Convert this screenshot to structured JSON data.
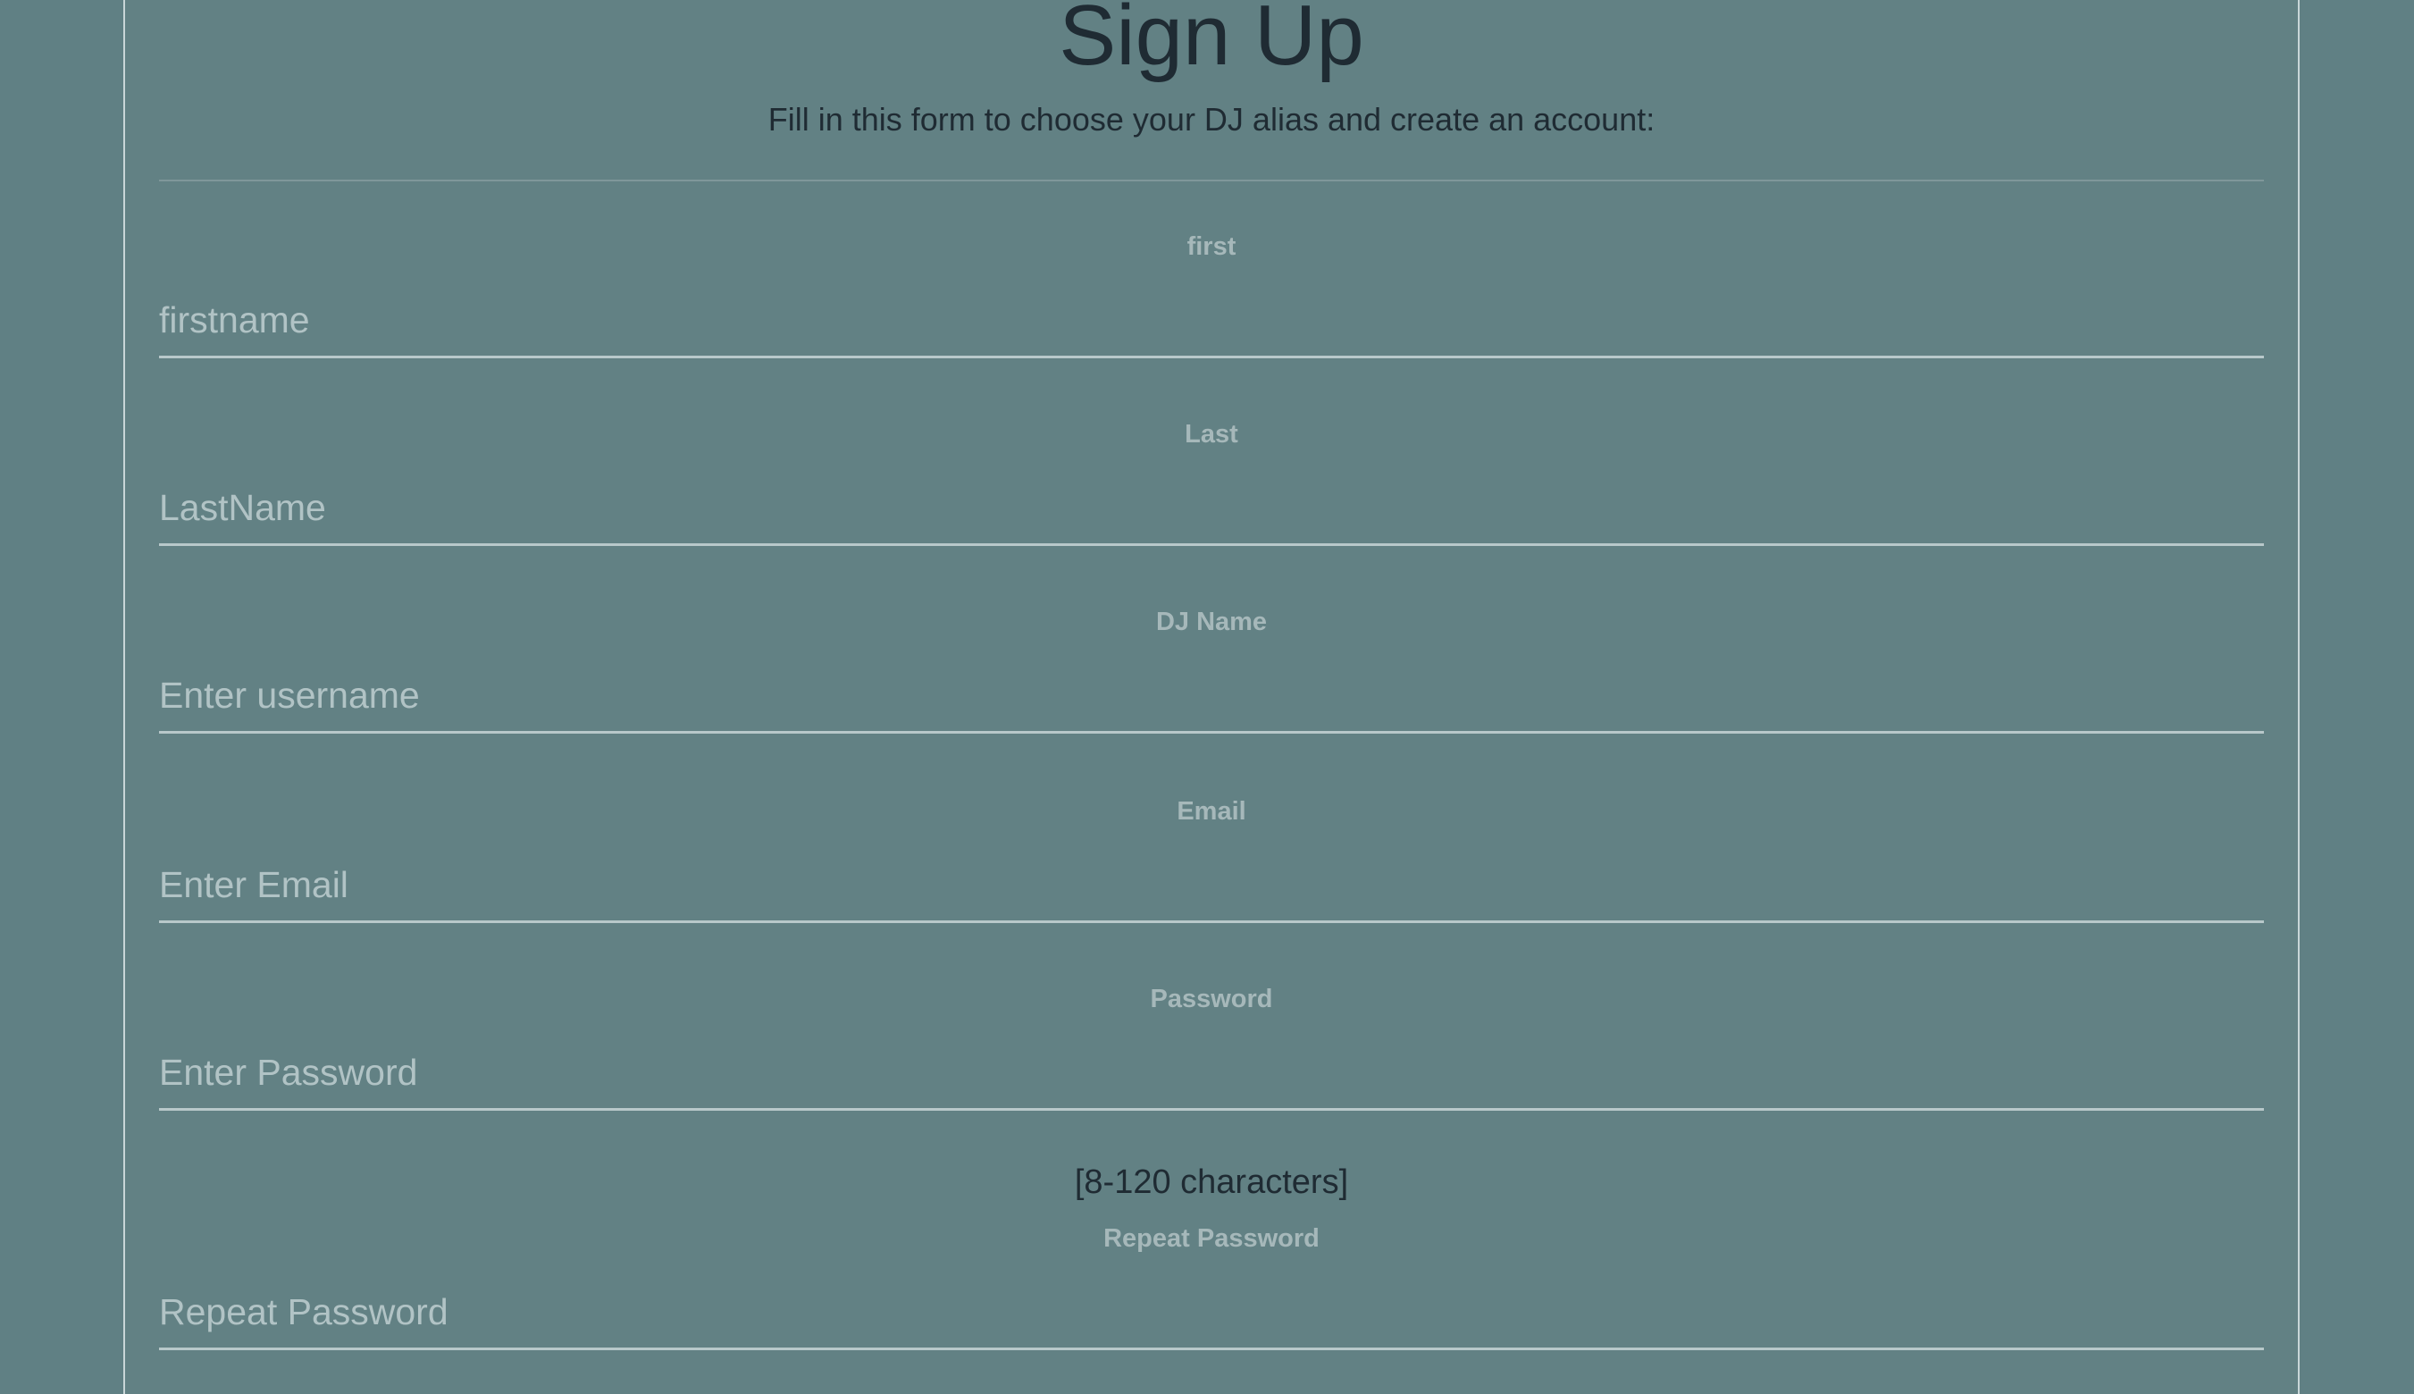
{
  "form": {
    "title": "Sign Up",
    "subtitle": "Fill in this form to choose your DJ alias and create an account:",
    "fields": [
      {
        "label": "first",
        "placeholder": "firstname"
      },
      {
        "label": "Last",
        "placeholder": "LastName"
      },
      {
        "label": "DJ Name",
        "placeholder": "Enter username"
      },
      {
        "label": "Email",
        "placeholder": "Enter Email"
      },
      {
        "label": "Password",
        "placeholder": "Enter Password"
      },
      {
        "label": "Repeat Password",
        "placeholder": "Repeat Password"
      }
    ],
    "password_hint": "[8-120 characters]"
  },
  "colors": {
    "background": "#608084",
    "title_text": "#1f2b33",
    "label_text": "#a6b8ba",
    "placeholder_text": "#b1c3c5",
    "input_underline": "#b8c8ca"
  }
}
